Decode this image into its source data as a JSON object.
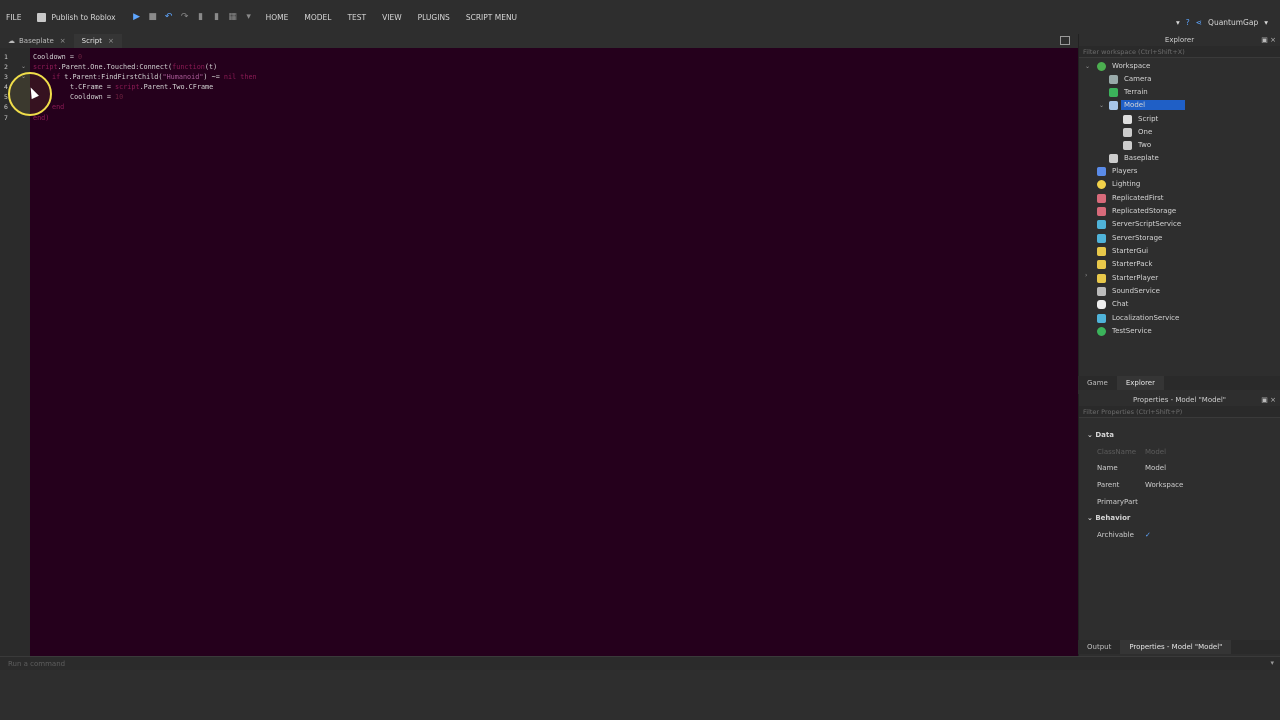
{
  "menu": {
    "file": "FILE",
    "publish": "Publish to Roblox",
    "tabs": [
      "HOME",
      "MODEL",
      "TEST",
      "VIEW",
      "PLUGINS",
      "SCRIPT MENU"
    ],
    "user": "QuantumGap"
  },
  "editor_tabs": [
    {
      "label": "Baseplate"
    },
    {
      "label": "Script"
    }
  ],
  "code": {
    "line_numbers": [
      "1",
      "2",
      "3",
      "4",
      "5",
      "6",
      "7"
    ],
    "l1_a": "Cooldown = ",
    "l1_b": "0",
    "l2_a": "script",
    "l2_b": ".Parent.One.Touched:Connect(",
    "l2_c": "function",
    "l2_d": "(t)",
    "l3_a": "if",
    "l3_b": " t.Parent:FindFirstChild(",
    "l3_c": "\"Humanoid\"",
    "l3_d": ") ~= ",
    "l3_e": "nil then",
    "l4_a": "t.CFrame = ",
    "l4_b": "script",
    "l4_c": ".Parent.Two.CFrame",
    "l5_a": "Cooldown = ",
    "l5_b": "10",
    "l6": "end",
    "l7": "end)"
  },
  "command_bar": {
    "placeholder": "Run a command"
  },
  "explorer": {
    "title": "Explorer",
    "filter": "Filter workspace (Ctrl+Shift+X)",
    "items": [
      "Workspace",
      "Camera",
      "Terrain",
      "Model",
      "Script",
      "One",
      "Two",
      "Baseplate",
      "Players",
      "Lighting",
      "ReplicatedFirst",
      "ReplicatedStorage",
      "ServerScriptService",
      "ServerStorage",
      "StarterGui",
      "StarterPack",
      "StarterPlayer",
      "SoundService",
      "Chat",
      "LocalizationService",
      "TestService"
    ]
  },
  "panel_tabs": [
    "Game",
    "Explorer"
  ],
  "properties": {
    "title": "Properties - Model \"Model\"",
    "filter": "Filter Properties (Ctrl+Shift+P)",
    "section_data": "Data",
    "classname_label": "ClassName",
    "classname_value": "Model",
    "name_label": "Name",
    "name_value": "Model",
    "parent_label": "Parent",
    "parent_value": "Workspace",
    "primarypart_label": "PrimaryPart",
    "section_behavior": "Behavior",
    "archivable_label": "Archivable",
    "archivable_value": "✓"
  },
  "bottom_tabs": [
    "Output",
    "Properties - Model \"Model\""
  ],
  "colors": {
    "editor_bg": "#25001c",
    "selection": "#1f5fc6",
    "cursor_ring": "#f0de4a"
  }
}
